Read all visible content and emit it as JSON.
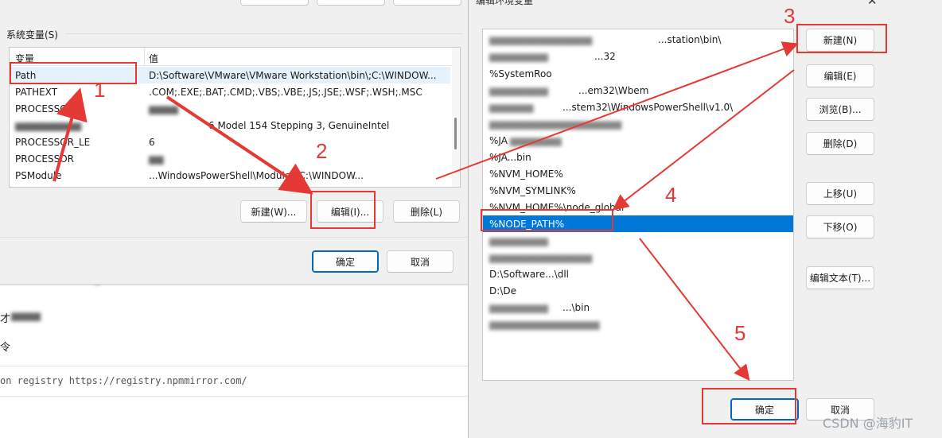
{
  "left_dialog": {
    "group_title": "系统变量(S)",
    "columns": [
      "变量",
      "值"
    ],
    "rows": [
      {
        "name": "Path",
        "value": "D:\\Software\\VMware\\VMware Workstation\\bin\\;C:\\WINDOW..."
      },
      {
        "name": "PATHEXT",
        "value": ".COM;.EXE;.BAT;.CMD;.VBS;.VBE;.JS;.JSE;.WSF;.WSH;.MSC"
      },
      {
        "name": "PROCESSOR_A",
        "value": ""
      },
      {
        "name": "",
        "value": "6 Model 154 Stepping 3, GenuineIntel"
      },
      {
        "name": "PROCESSOR_LE",
        "value": "6"
      },
      {
        "name": "PROCESSOR",
        "value": ""
      },
      {
        "name": "PSModule",
        "value": "...WindowsPowerShell\\Modules;C:\\WINDOW..."
      }
    ],
    "buttons": {
      "new": "新建(W)...",
      "edit": "编辑(I)...",
      "delete": "删除(L)"
    },
    "ok": "确定",
    "cancel": "取消"
  },
  "background_page": {
    "line1": "才",
    "line2": "令",
    "code": "on  registry https://registry.npmmirror.com/",
    "frag": "4"
  },
  "right_dialog": {
    "title": "编辑环境变量",
    "paths": [
      "...station\\bin\\",
      "...32",
      "%SystemRoo",
      "...em32\\Wbem",
      "...stem32\\WindowsPowerShell\\v1.0\\",
      "",
      "%JA",
      "%JA...bin",
      "%NVM_HOME%",
      "%NVM_SYMLINK%",
      "%NVM_HOME%\\node_global",
      "%NODE_PATH%",
      "",
      "",
      "D:\\Software...\\dll",
      "D:\\De",
      "...\\bin",
      ""
    ],
    "selected_index": 11,
    "buttons": {
      "new": "新建(N)",
      "edit": "编辑(E)",
      "browse": "浏览(B)...",
      "delete": "删除(D)",
      "up": "上移(U)",
      "down": "下移(O)",
      "edit_text": "编辑文本(T)..."
    },
    "ok": "确定",
    "cancel": "取消"
  },
  "annotations": {
    "steps": [
      "1",
      "2",
      "3",
      "4",
      "5"
    ],
    "color": "#e53935"
  },
  "watermark": "CSDN @海豹IT"
}
